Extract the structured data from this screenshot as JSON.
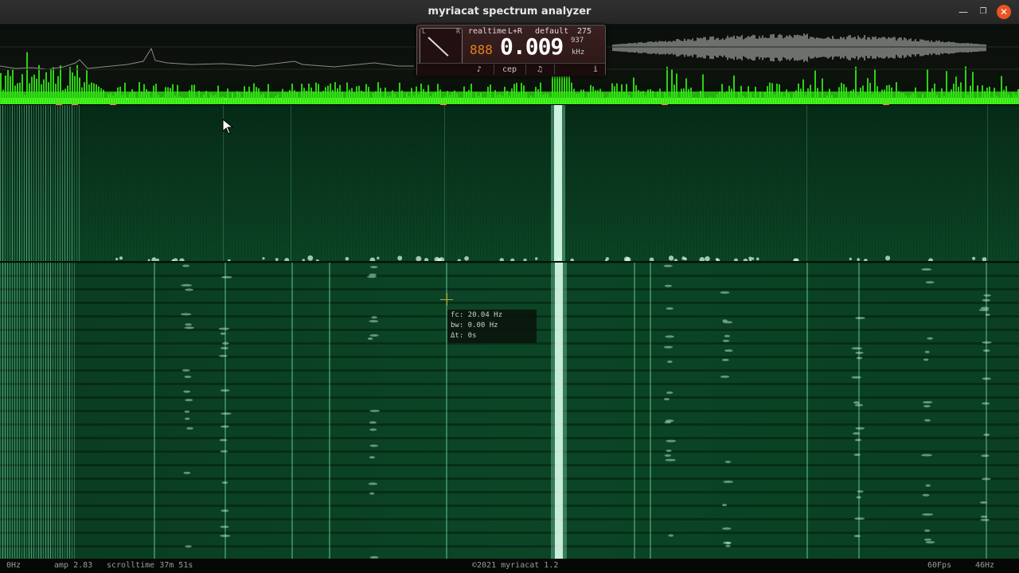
{
  "window": {
    "title": "myriacat spectrum analyzer",
    "controls": [
      "minimize",
      "maximize",
      "close"
    ],
    "close_icon": "close-icon"
  },
  "panel": {
    "dial_left": "L",
    "dial_right": "R",
    "mode": "realtime",
    "channel": "L+R",
    "preset": "default",
    "count": "275",
    "small_digits": "888",
    "frequency": "0.009",
    "sub_value": "937",
    "unit": "kHz",
    "buttons": {
      "note": "♪",
      "cep": "cep",
      "music": "♫",
      "info": "i"
    }
  },
  "tooltip": {
    "fc": "fc: 20.04 Hz",
    "bw": "bw: 0.00 Hz",
    "dt": "Δt: 0s"
  },
  "status": {
    "left_freq": "0Hz",
    "amp": "amp 2.83",
    "scrolltime": "scrolltime 37m 51s",
    "copyright": "©2021 myriacat 1.2",
    "fps": "60Fps",
    "right_freq": "46Hz"
  },
  "colors": {
    "spectrum_green": "#39ff14",
    "waterfall_bg": "#0b4424",
    "marker": "#c9a030",
    "close_button": "#e95420"
  }
}
